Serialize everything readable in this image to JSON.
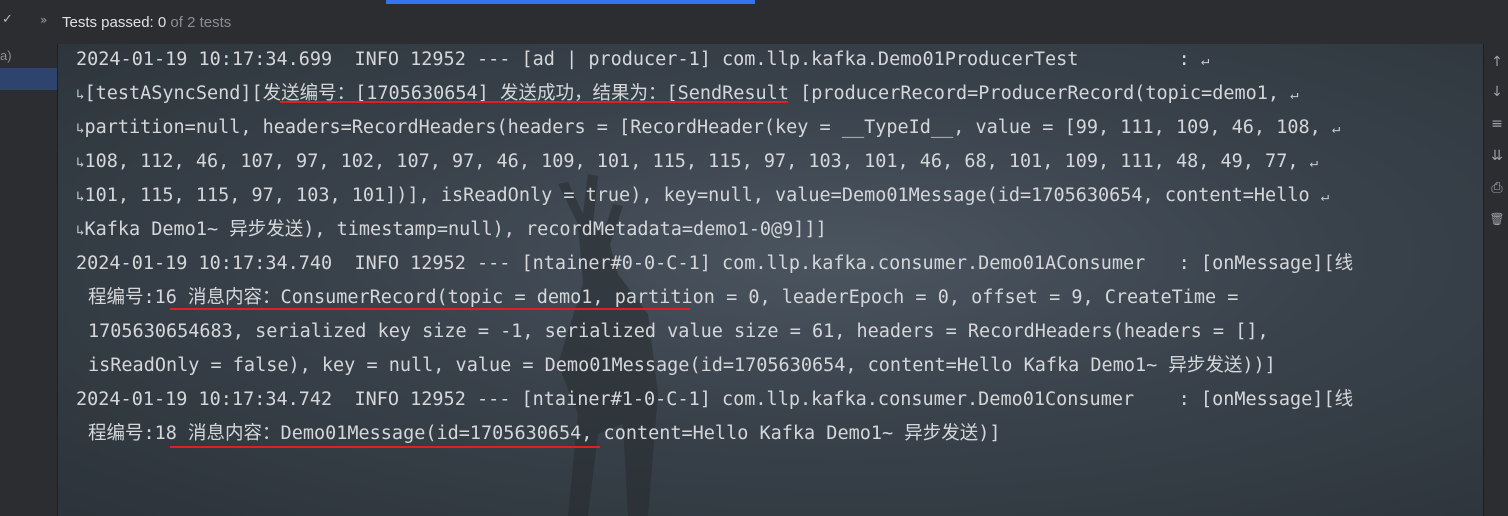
{
  "topbar": {
    "check_icon": "check-icon",
    "chevron_glyph": "»",
    "status_prefix": "Tests passed:",
    "passed_count": "0",
    "total_text": "of 2 tests"
  },
  "left_panel": {
    "label": "a)"
  },
  "console": {
    "lines": [
      "2024-01-19 10:17:34.699  INFO 12952 --- [ad | producer-1] com.llp.kafka.Demo01ProducerTest         : ",
      "[testASyncSend][发送编号：[1705630654] 发送成功，结果为：[SendResult [producerRecord=ProducerRecord(topic=demo1, ",
      "partition=null, headers=RecordHeaders(headers = [RecordHeader(key = __TypeId__, value = [99, 111, 109, 46, 108, ",
      "108, 112, 46, 107, 97, 102, 107, 97, 46, 109, 101, 115, 115, 97, 103, 101, 46, 68, 101, 109, 111, 48, 49, 77, ",
      "101, 115, 115, 97, 103, 101])], isReadOnly = true), key=null, value=Demo01Message(id=1705630654, content=Hello ",
      "Kafka Demo1~ 异步发送), timestamp=null), recordMetadata=demo1-0@9]]]",
      "2024-01-19 10:17:34.740  INFO 12952 --- [ntainer#0-0-C-1] com.llp.kafka.consumer.Demo01AConsumer   : [onMessage][线",
      "程编号:16 消息内容：ConsumerRecord(topic = demo1, partition = 0, leaderEpoch = 0, offset = 9, CreateTime = ",
      "1705630654683, serialized key size = -1, serialized value size = 61, headers = RecordHeaders(headers = [], ",
      "isReadOnly = false), key = null, value = Demo01Message(id=1705630654, content=Hello Kafka Demo1~ 异步发送))]",
      "2024-01-19 10:17:34.742  INFO 12952 --- [ntainer#1-0-C-1] com.llp.kafka.consumer.Demo01Consumer    : [onMessage][线",
      "程编号:18 消息内容：Demo01Message(id=1705630654, content=Hello Kafka Demo1~ 异步发送)]"
    ],
    "wrap_glyph": "↵",
    "wrap_start_glyph": "↳"
  },
  "right_toolbar": {
    "icons": [
      "up-arrow-icon",
      "down-arrow-icon",
      "soft-wrap-icon",
      "scroll-to-end-icon",
      "print-icon",
      "trash-icon"
    ],
    "glyphs": [
      "↑",
      "↓",
      "≡",
      "⇊",
      "⎙",
      "🗑"
    ]
  },
  "annotation_color": "#e02020"
}
